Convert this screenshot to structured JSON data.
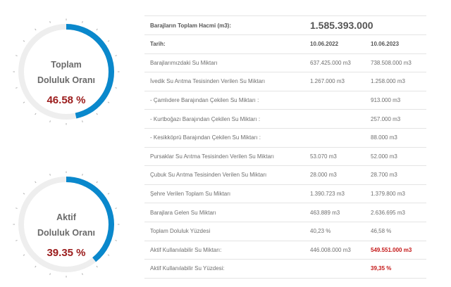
{
  "colors": {
    "accent": "#0a88cc",
    "track": "#eeeeee",
    "tick": "#b0b0b0",
    "value_red": "#9b1c1c",
    "highlight_red": "#c41717"
  },
  "gauges": [
    {
      "title_line1": "Toplam",
      "title_line2": "Doluluk Oranı",
      "value_text": "46.58 %",
      "fraction": 0.4658
    },
    {
      "title_line1": "Aktif",
      "title_line2": "Doluluk Oranı",
      "value_text": "39.35 %",
      "fraction": 0.3935
    }
  ],
  "table": {
    "total_label": "Barajların Toplam Hacmi (m3):",
    "total_value": "1.585.393.000",
    "date_label": "Tarih:",
    "date1": "10.06.2022",
    "date2": "10.06.2023",
    "rows": [
      {
        "label": "Barajlarımızdaki Su Miktarı",
        "v1": "637.425.000 m3",
        "v2": "738.508.000 m3"
      },
      {
        "label": "İvedik Su Arıtma Tesisinden Verilen Su Miktarı",
        "v1": "1.267.000 m3",
        "v2": "1.258.000 m3"
      },
      {
        "label": "- Çamlıdere Barajından Çekilen Su Miktarı :",
        "v1": "",
        "v2": "913.000 m3"
      },
      {
        "label": "- Kurtboğazı Barajından Çekilen Su Miktarı :",
        "v1": "",
        "v2": "257.000 m3"
      },
      {
        "label": "- Kesikköprü Barajından Çekilen Su Miktarı :",
        "v1": "",
        "v2": "88.000 m3"
      },
      {
        "label": "Pursaklar Su Arıtma Tesisinden Verilen Su Miktarı",
        "v1": "53.070 m3",
        "v2": "52.000 m3"
      },
      {
        "label": "Çubuk Su Arıtma Tesisinden Verilen Su Miktarı",
        "v1": "28.000 m3",
        "v2": "28.700 m3"
      },
      {
        "label": "Şehre Verilen Toplam Su Miktarı",
        "v1": "1.390.723 m3",
        "v2": "1.379.800 m3"
      },
      {
        "label": "Barajlara Gelen Su Miktarı",
        "v1": "463.889 m3",
        "v2": "2.636.695 m3"
      },
      {
        "label": "Toplam Doluluk Yüzdesi",
        "v1": "40,23 %",
        "v2": "46,58 %"
      },
      {
        "label": "Aktif Kullanılabilir Su Miktarı:",
        "v1": "446.008.000 m3",
        "v2": "549.551.000 m3"
      },
      {
        "label": "Aktif Kullanılabilir Su Yüzdesi:",
        "v1": "",
        "v2": "39,35 %"
      }
    ]
  }
}
